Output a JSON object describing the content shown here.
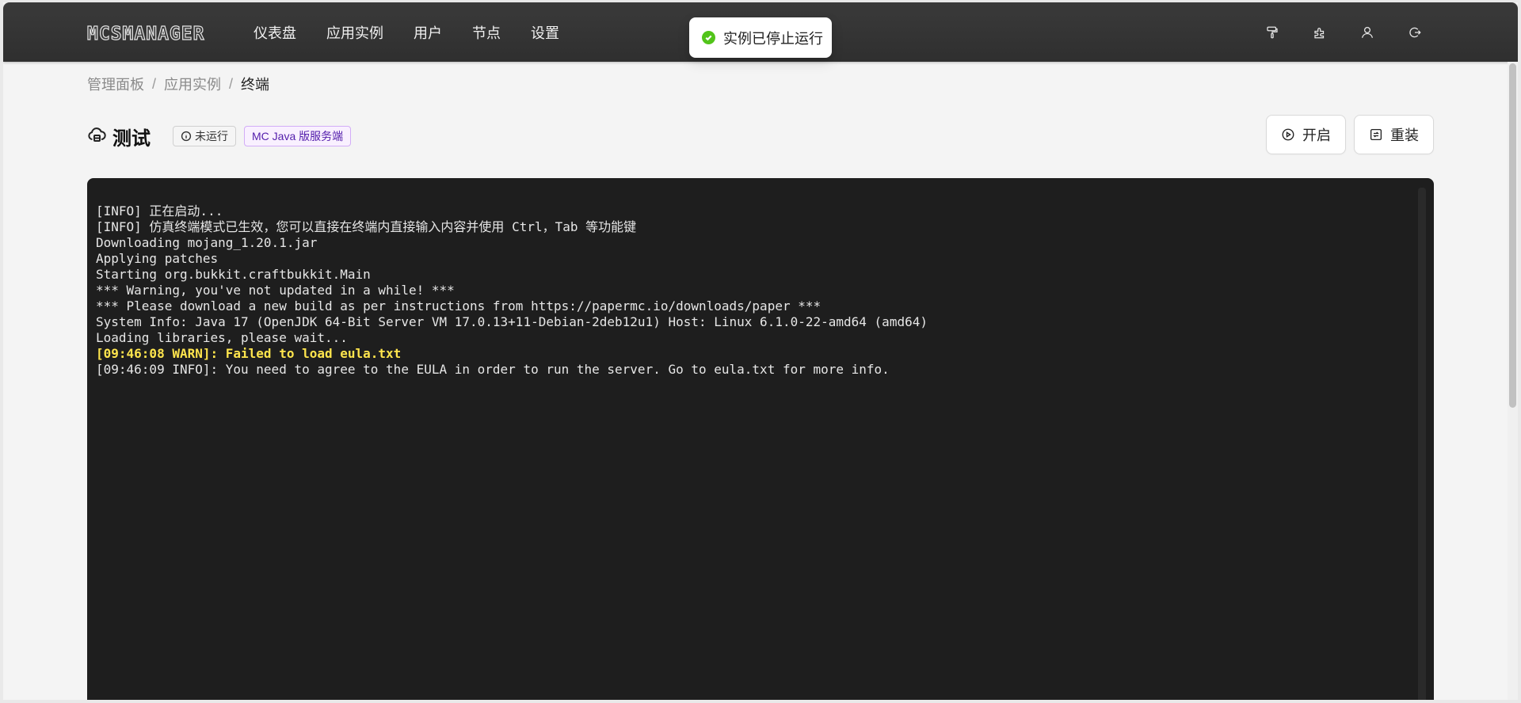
{
  "brand": {
    "logo_text": "MCSMANAGER"
  },
  "nav": {
    "items": [
      {
        "label": "仪表盘"
      },
      {
        "label": "应用实例"
      },
      {
        "label": "用户"
      },
      {
        "label": "节点"
      },
      {
        "label": "设置"
      }
    ]
  },
  "top_icons": [
    "paint-roller-icon",
    "puzzle-icon",
    "user-icon",
    "logout-icon"
  ],
  "toast": {
    "text": "实例已停止运行",
    "status_color": "#52c41a"
  },
  "breadcrumb": {
    "items": [
      {
        "label": "管理面板"
      },
      {
        "label": "应用实例"
      },
      {
        "label": "终端"
      }
    ],
    "separator": "/"
  },
  "instance": {
    "name": "测试",
    "status": "未运行",
    "type": "MC Java 版服务端"
  },
  "actions": {
    "start_label": "开启",
    "reinstall_label": "重装"
  },
  "terminal": {
    "lines": [
      {
        "text": "[INFO] 正在启动...",
        "level": "info"
      },
      {
        "text": "[INFO] 仿真终端模式已生效，您可以直接在终端内直接输入内容并使用 Ctrl，Tab 等功能键",
        "level": "info"
      },
      {
        "text": "Downloading mojang_1.20.1.jar",
        "level": "info"
      },
      {
        "text": "Applying patches",
        "level": "info"
      },
      {
        "text": "Starting org.bukkit.craftbukkit.Main",
        "level": "info"
      },
      {
        "text": "*** Warning, you've not updated in a while! ***",
        "level": "info"
      },
      {
        "text": "*** Please download a new build as per instructions from https://papermc.io/downloads/paper ***",
        "level": "info"
      },
      {
        "text": "System Info: Java 17 (OpenJDK 64-Bit Server VM 17.0.13+11-Debian-2deb12u1) Host: Linux 6.1.0-22-amd64 (amd64)",
        "level": "info"
      },
      {
        "text": "Loading libraries, please wait...",
        "level": "info"
      },
      {
        "text": "[09:46:08 WARN]: Failed to load eula.txt",
        "level": "warn"
      },
      {
        "text": "[09:46:09 INFO]: You need to agree to the EULA in order to run the server. Go to eula.txt for more info.",
        "level": "info"
      }
    ],
    "warn_color": "#ffe54d"
  }
}
